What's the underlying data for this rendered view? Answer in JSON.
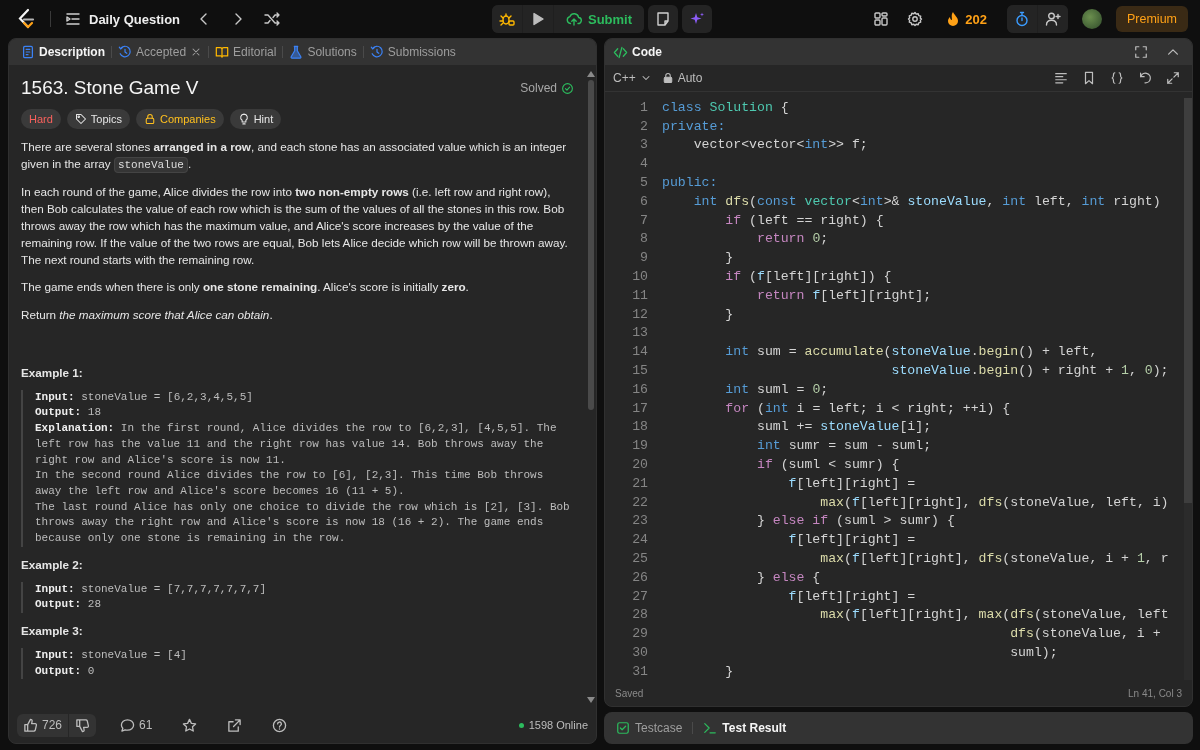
{
  "header": {
    "title": "Daily Question",
    "submit": "Submit",
    "streak": "202",
    "premium": "Premium"
  },
  "description_panel": {
    "tabs": [
      {
        "label": "Description",
        "selected": true,
        "closable": false
      },
      {
        "label": "Accepted",
        "selected": false,
        "closable": true
      },
      {
        "label": "Editorial",
        "selected": false,
        "closable": false
      },
      {
        "label": "Solutions",
        "selected": false,
        "closable": false
      },
      {
        "label": "Submissions",
        "selected": false,
        "closable": false
      }
    ],
    "problem": {
      "title": "1563. Stone Game V",
      "status": "Solved",
      "solved": true,
      "tags": [
        {
          "kind": "difficulty",
          "label": "Hard"
        },
        {
          "kind": "topics",
          "label": "Topics"
        },
        {
          "kind": "companies",
          "label": "Companies"
        },
        {
          "kind": "hint",
          "label": "Hint"
        }
      ],
      "paragraphs": [
        {
          "segments": [
            {
              "kind": "text",
              "text": "There are several stones **arranged in a row**, and each stone has an associated value which is an integer given in the array"
            },
            {
              "kind": "code",
              "text": "stoneValue"
            },
            {
              "kind": "text",
              "text": "."
            }
          ]
        },
        {
          "segments": [
            {
              "kind": "text",
              "text": "In each round of the game, Alice divides the row into **two non-empty rows** (i.e. left row and right row), then Bob calculates the value of each row which is the sum of the values of all the stones in this row. Bob throws away the row which has the maximum value, and Alice's score increases by the value of the remaining row. If the value of the two rows are equal, Bob lets Alice decide which row will be thrown away. The next round starts with the remaining row."
            }
          ]
        },
        {
          "segments": [
            {
              "kind": "text",
              "text": "The game ends when there is only **one stone remaining**. Alice's score is initially **zero**."
            }
          ]
        },
        {
          "segments": [
            {
              "kind": "text",
              "text": "Return *the maximum score that Alice can obtain*."
            }
          ]
        }
      ],
      "examples": [
        {
          "title": "Example 1:",
          "lines": [
            {
              "label": "Input:",
              "value": "stoneValue = [6,2,3,4,5,5]"
            },
            {
              "label": "Output:",
              "value": "18"
            },
            {
              "label": "Explanation:",
              "value": "In the first round, Alice divides the row to [6,2,3], [4,5,5]. The left row has the value 11 and the right row has value 14. Bob throws away the right row and Alice's score is now 11.\nIn the second round Alice divides the row to [6], [2,3]. This time Bob throws away the left row and Alice's score becomes 16 (11 + 5).\nThe last round Alice has only one choice to divide the row which is [2], [3]. Bob throws away the right row and Alice's score is now 18 (16 + 2). The game ends because only one stone is remaining in the row."
            }
          ]
        },
        {
          "title": "Example 2:",
          "lines": [
            {
              "label": "Input:",
              "value": "stoneValue = [7,7,7,7,7,7,7]"
            },
            {
              "label": "Output:",
              "value": "28"
            }
          ]
        },
        {
          "title": "Example 3:",
          "lines": [
            {
              "label": "Input:",
              "value": "stoneValue = [4]"
            },
            {
              "label": "Output:",
              "value": "0"
            }
          ]
        }
      ]
    },
    "footer": {
      "likes": "726",
      "comments": "61",
      "online": "1598 Online"
    }
  },
  "code_panel": {
    "title": "Code",
    "language": "C++",
    "mode": "Auto",
    "save_status": "Saved",
    "cursor": "Ln 41, Col 3",
    "lines": [
      {
        "number": "1",
        "tokens": [
          {
            "kind": "keyword",
            "text": "class "
          },
          {
            "kind": "type",
            "text": "Solution"
          },
          {
            "kind": "plain",
            "text": " {"
          }
        ]
      },
      {
        "number": "2",
        "tokens": [
          {
            "kind": "keyword",
            "text": "private:"
          }
        ]
      },
      {
        "number": "3",
        "tokens": [
          {
            "kind": "plain",
            "text": "    vector<vector<"
          },
          {
            "kind": "keyword",
            "text": "int"
          },
          {
            "kind": "plain",
            "text": ">> f;"
          }
        ]
      },
      {
        "number": "4"
      },
      {
        "number": "5",
        "tokens": [
          {
            "kind": "keyword",
            "text": "public:"
          }
        ]
      },
      {
        "number": "6",
        "tokens": [
          {
            "kind": "keyword",
            "text": "    int "
          },
          {
            "kind": "function",
            "text": "dfs"
          },
          {
            "kind": "plain",
            "text": "("
          },
          {
            "kind": "keyword",
            "text": "const "
          },
          {
            "kind": "type",
            "text": "vector"
          },
          {
            "kind": "plain",
            "text": "<"
          },
          {
            "kind": "keyword",
            "text": "int"
          },
          {
            "kind": "plain",
            "text": ">& "
          },
          {
            "kind": "variable",
            "text": "stoneValue"
          },
          {
            "kind": "plain",
            "text": ", "
          },
          {
            "kind": "keyword",
            "text": "int"
          },
          {
            "kind": "plain",
            "text": " left, "
          },
          {
            "kind": "keyword",
            "text": "int"
          },
          {
            "kind": "plain",
            "text": " right)"
          }
        ]
      },
      {
        "number": "7",
        "tokens": [
          {
            "kind": "control",
            "text": "        if"
          },
          {
            "kind": "plain",
            "text": " (left == right) {"
          }
        ]
      },
      {
        "number": "8",
        "tokens": [
          {
            "kind": "control",
            "text": "            return "
          },
          {
            "kind": "number",
            "text": "0"
          },
          {
            "kind": "plain",
            "text": ";"
          }
        ]
      },
      {
        "number": "9",
        "tokens": [
          {
            "kind": "plain",
            "text": "        }"
          }
        ]
      },
      {
        "number": "10",
        "tokens": [
          {
            "kind": "control",
            "text": "        if"
          },
          {
            "kind": "plain",
            "text": " ("
          },
          {
            "kind": "variable",
            "text": "f"
          },
          {
            "kind": "plain",
            "text": "[left][right]) {"
          }
        ]
      },
      {
        "number": "11",
        "tokens": [
          {
            "kind": "control",
            "text": "            return "
          },
          {
            "kind": "variable",
            "text": "f"
          },
          {
            "kind": "plain",
            "text": "[left][right];"
          }
        ]
      },
      {
        "number": "12",
        "tokens": [
          {
            "kind": "plain",
            "text": "        }"
          }
        ]
      },
      {
        "number": "13"
      },
      {
        "number": "14",
        "tokens": [
          {
            "kind": "keyword",
            "text": "        int"
          },
          {
            "kind": "plain",
            "text": " sum = "
          },
          {
            "kind": "function",
            "text": "accumulate"
          },
          {
            "kind": "plain",
            "text": "("
          },
          {
            "kind": "variable",
            "text": "stoneValue"
          },
          {
            "kind": "plain",
            "text": "."
          },
          {
            "kind": "function",
            "text": "begin"
          },
          {
            "kind": "plain",
            "text": "() + left,"
          }
        ]
      },
      {
        "number": "15",
        "tokens": [
          {
            "kind": "variable",
            "text": "                             stoneValue"
          },
          {
            "kind": "plain",
            "text": "."
          },
          {
            "kind": "function",
            "text": "begin"
          },
          {
            "kind": "plain",
            "text": "() + right + "
          },
          {
            "kind": "number",
            "text": "1"
          },
          {
            "kind": "plain",
            "text": ", "
          },
          {
            "kind": "number",
            "text": "0"
          },
          {
            "kind": "plain",
            "text": ");"
          }
        ]
      },
      {
        "number": "16",
        "tokens": [
          {
            "kind": "keyword",
            "text": "        int"
          },
          {
            "kind": "plain",
            "text": " suml = "
          },
          {
            "kind": "number",
            "text": "0"
          },
          {
            "kind": "plain",
            "text": ";"
          }
        ]
      },
      {
        "number": "17",
        "tokens": [
          {
            "kind": "control",
            "text": "        for"
          },
          {
            "kind": "plain",
            "text": " ("
          },
          {
            "kind": "keyword",
            "text": "int"
          },
          {
            "kind": "plain",
            "text": " i = left; i < right; ++i) {"
          }
        ]
      },
      {
        "number": "18",
        "tokens": [
          {
            "kind": "plain",
            "text": "            suml += "
          },
          {
            "kind": "variable",
            "text": "stoneValue"
          },
          {
            "kind": "plain",
            "text": "[i];"
          }
        ]
      },
      {
        "number": "19",
        "tokens": [
          {
            "kind": "keyword",
            "text": "            int"
          },
          {
            "kind": "plain",
            "text": " sumr = sum - suml;"
          }
        ]
      },
      {
        "number": "20",
        "tokens": [
          {
            "kind": "control",
            "text": "            if"
          },
          {
            "kind": "plain",
            "text": " (suml < sumr) {"
          }
        ]
      },
      {
        "number": "21",
        "tokens": [
          {
            "kind": "variable",
            "text": "                f"
          },
          {
            "kind": "plain",
            "text": "[left][right] ="
          }
        ]
      },
      {
        "number": "22",
        "tokens": [
          {
            "kind": "function",
            "text": "                    max"
          },
          {
            "kind": "plain",
            "text": "("
          },
          {
            "kind": "variable",
            "text": "f"
          },
          {
            "kind": "plain",
            "text": "[left][right], "
          },
          {
            "kind": "function",
            "text": "dfs"
          },
          {
            "kind": "plain",
            "text": "(stoneValue, left, i)"
          }
        ]
      },
      {
        "number": "23",
        "tokens": [
          {
            "kind": "plain",
            "text": "            } "
          },
          {
            "kind": "control",
            "text": "else if"
          },
          {
            "kind": "plain",
            "text": " (suml > sumr) {"
          }
        ]
      },
      {
        "number": "24",
        "tokens": [
          {
            "kind": "variable",
            "text": "                f"
          },
          {
            "kind": "plain",
            "text": "[left][right] ="
          }
        ]
      },
      {
        "number": "25",
        "tokens": [
          {
            "kind": "function",
            "text": "                    max"
          },
          {
            "kind": "plain",
            "text": "("
          },
          {
            "kind": "variable",
            "text": "f"
          },
          {
            "kind": "plain",
            "text": "[left][right], "
          },
          {
            "kind": "function",
            "text": "dfs"
          },
          {
            "kind": "plain",
            "text": "(stoneValue, i + "
          },
          {
            "kind": "number",
            "text": "1"
          },
          {
            "kind": "plain",
            "text": ", r"
          }
        ]
      },
      {
        "number": "26",
        "tokens": [
          {
            "kind": "plain",
            "text": "            } "
          },
          {
            "kind": "control",
            "text": "else"
          },
          {
            "kind": "plain",
            "text": " {"
          }
        ]
      },
      {
        "number": "27",
        "tokens": [
          {
            "kind": "variable",
            "text": "                f"
          },
          {
            "kind": "plain",
            "text": "[left][right] ="
          }
        ]
      },
      {
        "number": "28",
        "tokens": [
          {
            "kind": "function",
            "text": "                    max"
          },
          {
            "kind": "plain",
            "text": "("
          },
          {
            "kind": "variable",
            "text": "f"
          },
          {
            "kind": "plain",
            "text": "[left][right], "
          },
          {
            "kind": "function",
            "text": "max"
          },
          {
            "kind": "plain",
            "text": "("
          },
          {
            "kind": "function",
            "text": "dfs"
          },
          {
            "kind": "plain",
            "text": "(stoneValue, left"
          }
        ]
      },
      {
        "number": "29",
        "tokens": [
          {
            "kind": "function",
            "text": "                                            dfs"
          },
          {
            "kind": "plain",
            "text": "(stoneValue, i +"
          }
        ]
      },
      {
        "number": "30",
        "tokens": [
          {
            "kind": "plain",
            "text": "                                            suml);"
          }
        ]
      },
      {
        "number": "31",
        "tokens": [
          {
            "kind": "plain",
            "text": "        }"
          }
        ]
      }
    ]
  },
  "result_panel": {
    "tabs": [
      {
        "label": "Testcase",
        "selected": false
      },
      {
        "label": "Test Result",
        "selected": true
      }
    ]
  }
}
